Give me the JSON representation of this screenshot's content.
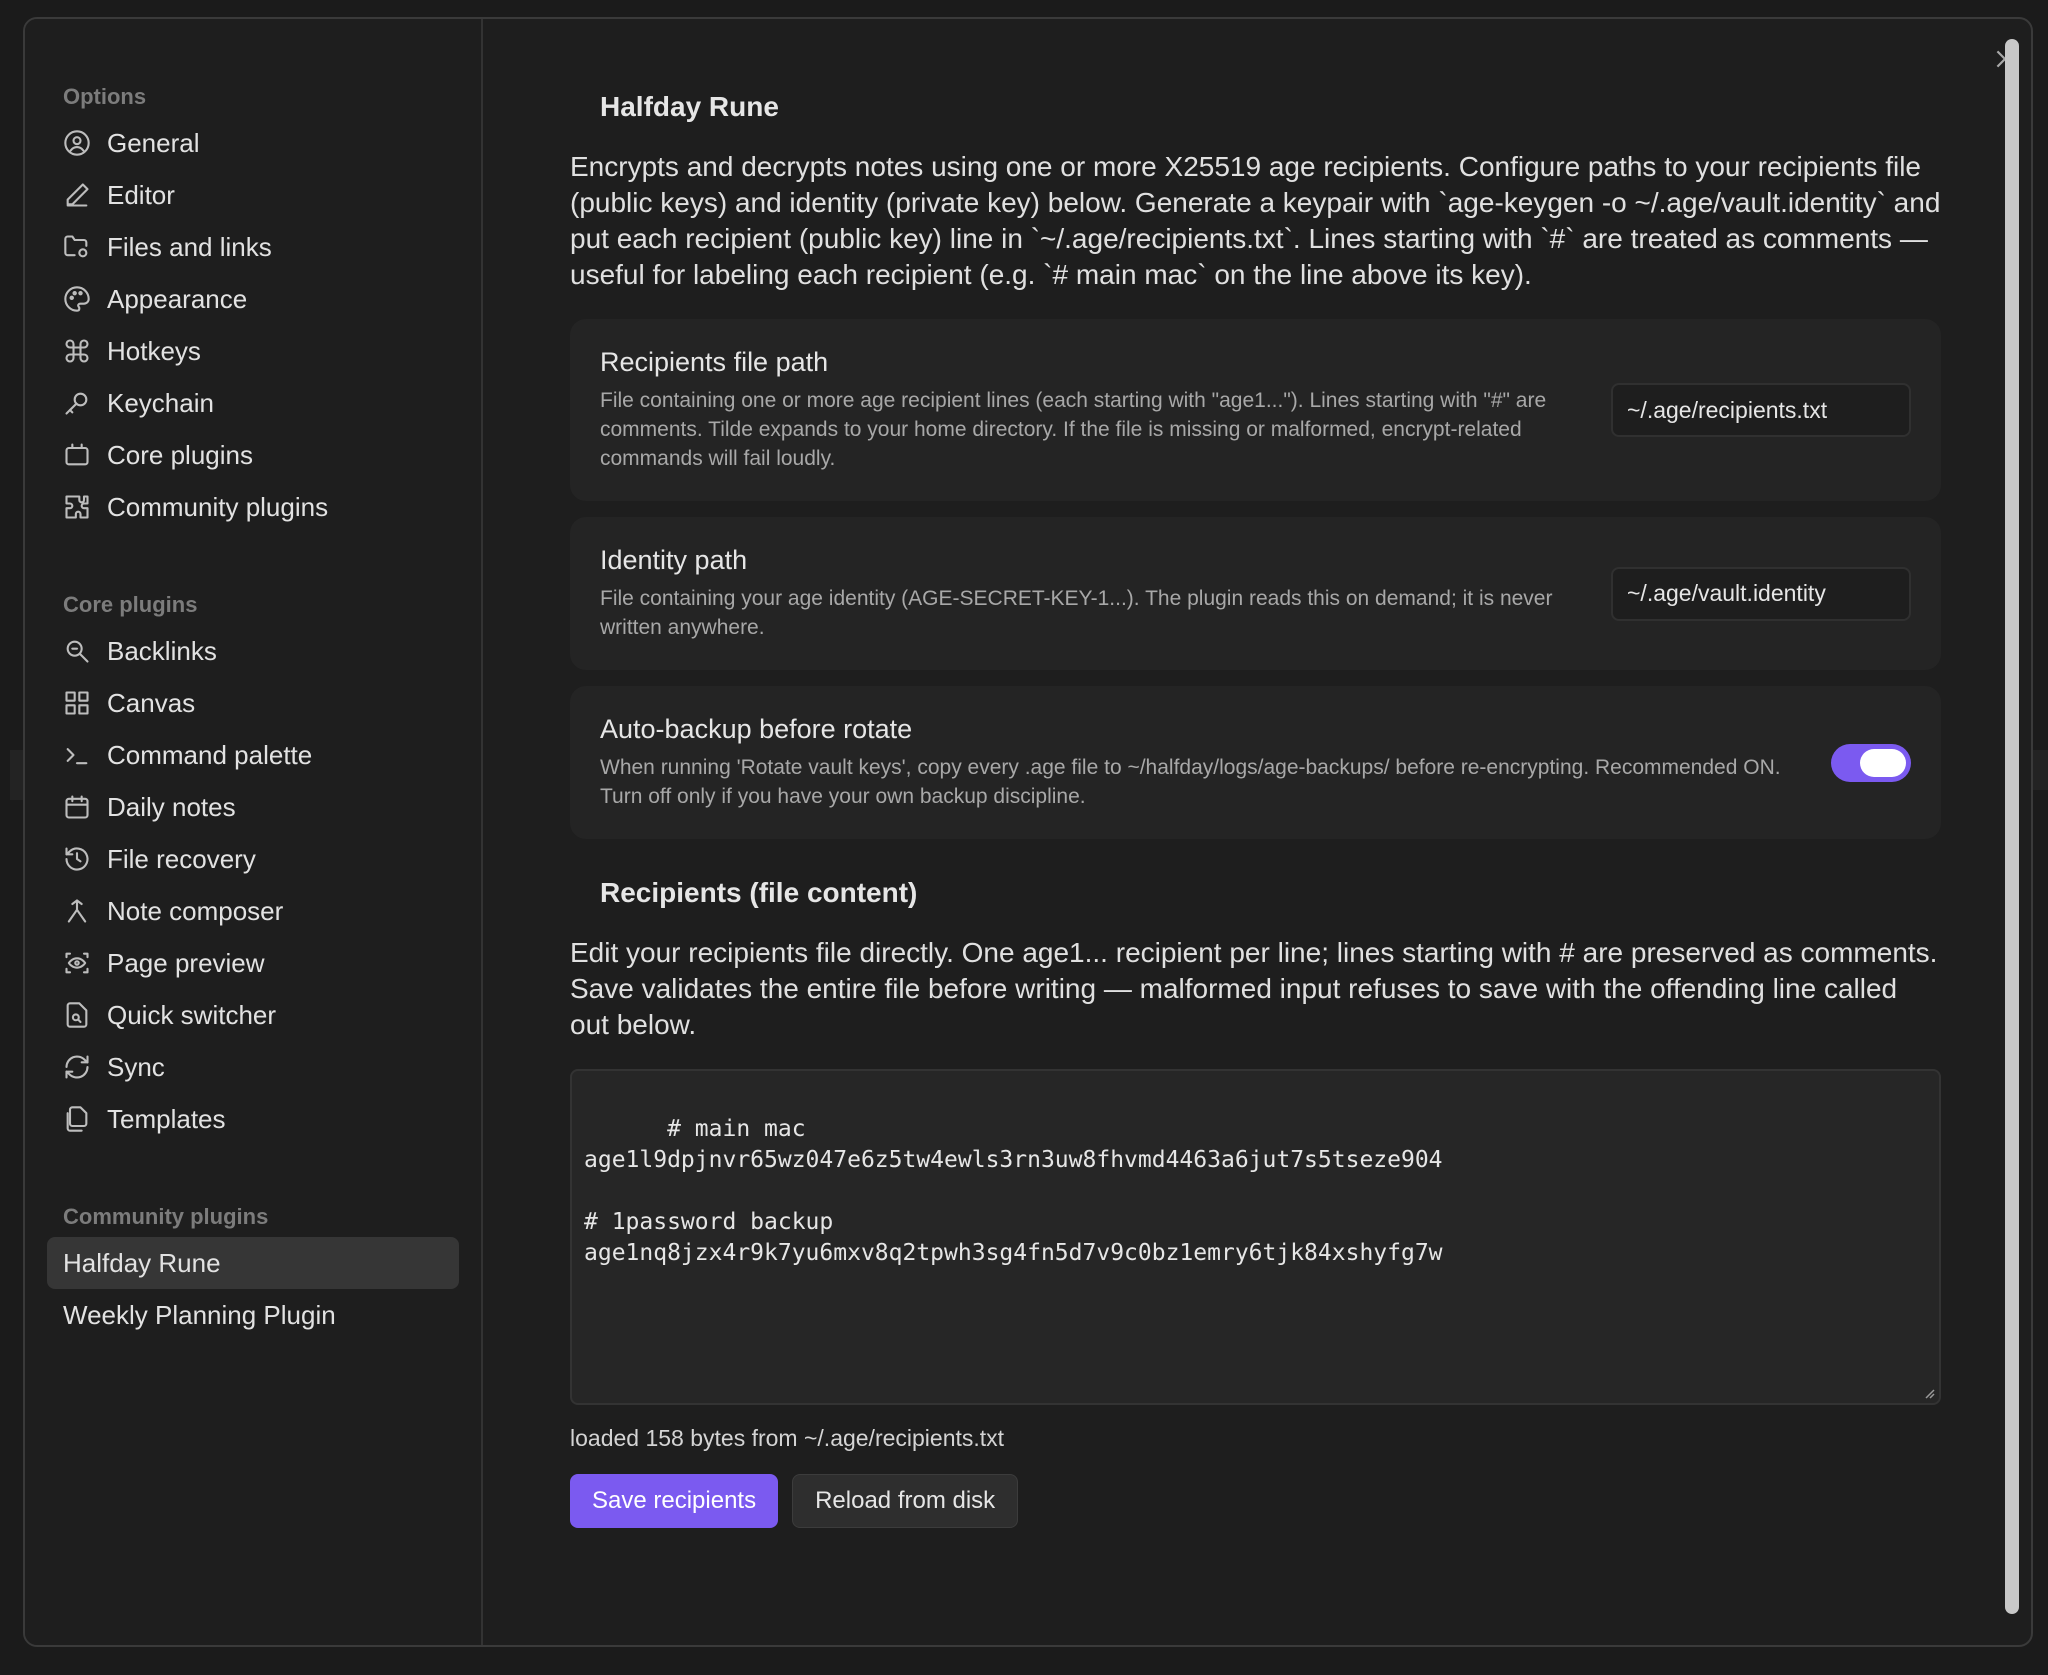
{
  "sidebar": {
    "groups": [
      {
        "title": "Options",
        "items": [
          {
            "label": "General",
            "icon": "user-circle-icon"
          },
          {
            "label": "Editor",
            "icon": "pencil-icon"
          },
          {
            "label": "Files and links",
            "icon": "folder-cog-icon"
          },
          {
            "label": "Appearance",
            "icon": "palette-icon"
          },
          {
            "label": "Hotkeys",
            "icon": "command-icon"
          },
          {
            "label": "Keychain",
            "icon": "key-icon"
          },
          {
            "label": "Core plugins",
            "icon": "plug-box-icon"
          },
          {
            "label": "Community plugins",
            "icon": "puzzle-icon"
          }
        ]
      },
      {
        "title": "Core plugins",
        "items": [
          {
            "label": "Backlinks",
            "icon": "backlinks-icon"
          },
          {
            "label": "Canvas",
            "icon": "grid-icon"
          },
          {
            "label": "Command palette",
            "icon": "terminal-icon"
          },
          {
            "label": "Daily notes",
            "icon": "calendar-icon"
          },
          {
            "label": "File recovery",
            "icon": "history-icon"
          },
          {
            "label": "Note composer",
            "icon": "merge-icon"
          },
          {
            "label": "Page preview",
            "icon": "eye-scan-icon"
          },
          {
            "label": "Quick switcher",
            "icon": "file-search-icon"
          },
          {
            "label": "Sync",
            "icon": "refresh-icon"
          },
          {
            "label": "Templates",
            "icon": "files-icon"
          }
        ]
      },
      {
        "title": "Community plugins",
        "items": [
          {
            "label": "Halfday Rune",
            "active": true
          },
          {
            "label": "Weekly Planning Plugin"
          }
        ]
      }
    ]
  },
  "main": {
    "title": "Halfday Rune",
    "intro": "Encrypts and decrypts notes using one or more X25519 age recipients. Configure paths to your recipients file (public keys) and identity (private key) below. Generate a keypair with `age-keygen -o ~/.age/vault.identity` and put each recipient (public key) line in `~/.age/recipients.txt`. Lines starting with `#` are treated as comments — useful for labeling each recipient (e.g. `# main mac` on the line above its key).",
    "settings": {
      "recipients_path": {
        "name": "Recipients file path",
        "desc": "File containing one or more age recipient lines (each starting with \"age1...\"). Lines starting with \"#\" are comments. Tilde expands to your home directory. If the file is missing or malformed, encrypt-related commands will fail loudly.",
        "value": "~/.age/recipients.txt"
      },
      "identity_path": {
        "name": "Identity path",
        "desc": "File containing your age identity (AGE-SECRET-KEY-1...). The plugin reads this on demand; it is never written anywhere.",
        "value": "~/.age/vault.identity"
      },
      "auto_backup": {
        "name": "Auto-backup before rotate",
        "desc": "When running 'Rotate vault keys', copy every .age file to ~/halfday/logs/age-backups/ before re-encrypting. Recommended ON. Turn off only if you have your own backup discipline.",
        "enabled": true
      }
    },
    "recipients_section": {
      "title": "Recipients (file content)",
      "desc": "Edit your recipients file directly. One age1... recipient per line; lines starting with # are preserved as comments. Save validates the entire file before writing — malformed input refuses to save with the offending line called out below.",
      "content": "# main mac\nage1l9dpjnvr65wz047e6z5tw4ewls3rn3uw8fhvmd4463a6jut7s5tseze904\n\n# 1password backup\nage1nq8jzx4r9k7yu6mxv8q2tpwh3sg4fn5d7v9c0bz1emry6tjk84xshyfg7w",
      "status": "loaded 158 bytes from ~/.age/recipients.txt",
      "save_label": "Save recipients",
      "reload_label": "Reload from disk"
    }
  },
  "colors": {
    "accent": "#7b5af0",
    "background": "#1e1e1e",
    "card": "#242424"
  }
}
